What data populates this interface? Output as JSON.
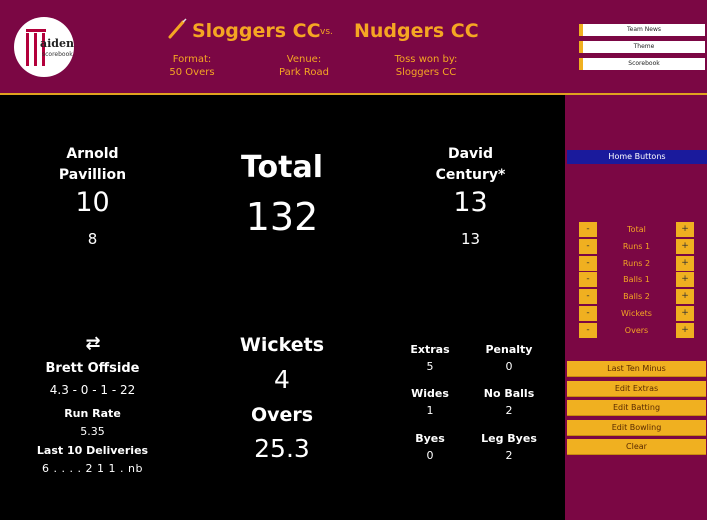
{
  "header": {
    "home_team": "Sloggers CC",
    "vs": "vs.",
    "away_team": "Nudgers CC",
    "format_label": "Format:",
    "format_value": "50 Overs",
    "venue_label": "Venue:",
    "venue_value": "Park Road",
    "toss_label": "Toss won by:",
    "toss_value": "Sloggers CC",
    "logo_text": "aiden",
    "logo_sub": "scorebook",
    "buttons": [
      "Team News",
      "Theme",
      "Scorebook"
    ]
  },
  "batters": {
    "left": {
      "name_line1": "Arnold",
      "name_line2": "Pavillion",
      "runs": "10",
      "balls": "8"
    },
    "right": {
      "name_line1": "David",
      "name_line2": "Century*",
      "runs": "13",
      "balls": "13"
    }
  },
  "total": {
    "label": "Total",
    "value": "132"
  },
  "bowler": {
    "swap_icon": "⇄",
    "name": "Brett Offside",
    "figures": "4.3 - 0 - 1 - 22",
    "run_rate_label": "Run Rate",
    "run_rate": "5.35",
    "last10_label": "Last 10 Deliveries",
    "last10": "6 . . . . 2 1 1 . nb"
  },
  "wickets": {
    "label": "Wickets",
    "value": "4"
  },
  "overs": {
    "label": "Overs",
    "value": "25.3"
  },
  "extras": {
    "extras_label": "Extras",
    "extras_value": "5",
    "penalty_label": "Penalty",
    "penalty_value": "0",
    "wides_label": "Wides",
    "wides_value": "1",
    "noballs_label": "No Balls",
    "noballs_value": "2",
    "byes_label": "Byes",
    "byes_value": "0",
    "legbyes_label": "Leg Byes",
    "legbyes_value": "2"
  },
  "sidebar": {
    "home_buttons": "Home Buttons",
    "minus": "-",
    "plus": "+",
    "controls": [
      "Total",
      "Runs 1",
      "Runs 2",
      "Balls 1",
      "Balls 2",
      "Wickets",
      "Overs"
    ],
    "actions": [
      "Last Ten Minus",
      "Edit Extras",
      "Edit Batting",
      "Edit Bowling",
      "Clear"
    ]
  },
  "colors": {
    "maroon": "#7b0744",
    "gold": "#f5a623",
    "button": "#f0b020",
    "blue": "#1a1a9c"
  }
}
